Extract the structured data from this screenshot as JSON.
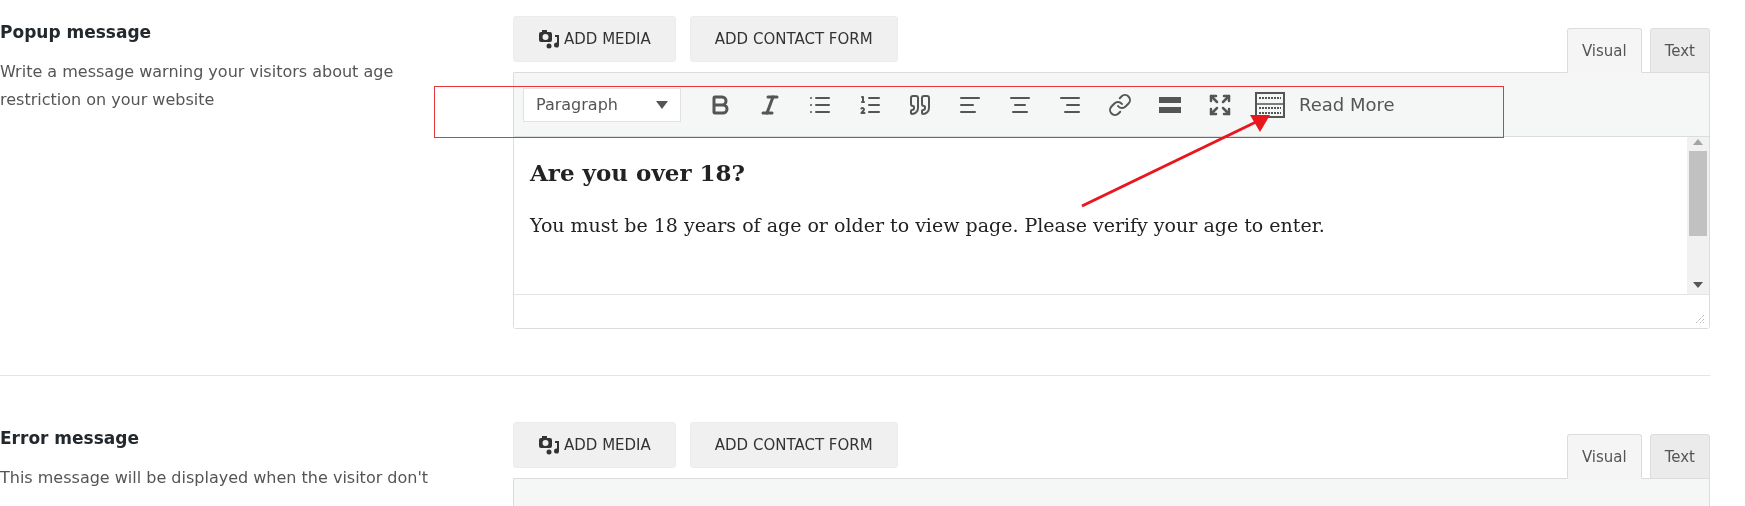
{
  "sections": [
    {
      "title": "Popup message",
      "description": "Write a message warning your visitors about age restriction on your website",
      "buttons": [
        "ADD MEDIA",
        "ADD CONTACT FORM"
      ],
      "tabs": [
        {
          "label": "Visual",
          "selected": true
        },
        {
          "label": "Text",
          "selected": false
        }
      ],
      "toolbar": {
        "format": "Paragraph",
        "read_more": "Read More"
      },
      "content": {
        "heading": "Are you over 18?",
        "paragraph": "You must be 18 years of age or older to view page. Please verify your age to enter."
      }
    },
    {
      "title": "Error message",
      "description": "This message will be displayed when the visitor don't",
      "buttons": [
        "ADD MEDIA",
        "ADD CONTACT FORM"
      ],
      "tabs": [
        {
          "label": "Visual",
          "selected": true
        },
        {
          "label": "Text",
          "selected": false
        }
      ]
    }
  ]
}
